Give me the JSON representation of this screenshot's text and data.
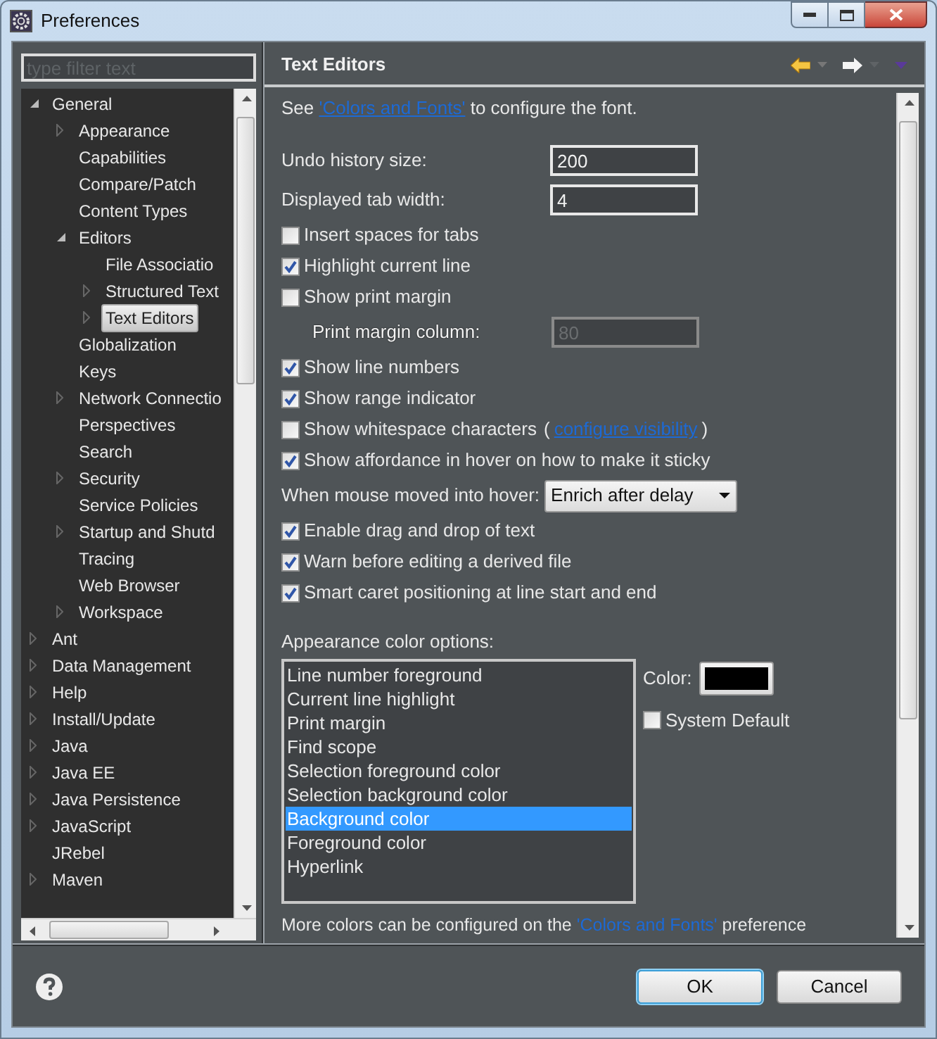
{
  "window": {
    "title": "Preferences"
  },
  "filter": {
    "placeholder": "type filter text"
  },
  "tree": [
    {
      "label": "General",
      "expanded": true,
      "selected": false,
      "children": [
        {
          "label": "Appearance",
          "expanded": false,
          "selected": false
        },
        {
          "label": "Capabilities",
          "selected": false
        },
        {
          "label": "Compare/Patch",
          "selected": false
        },
        {
          "label": "Content Types",
          "selected": false
        },
        {
          "label": "Editors",
          "expanded": true,
          "selected": false,
          "children": [
            {
              "label": "File Associatio",
              "selected": false
            },
            {
              "label": "Structured Text",
              "expanded": false,
              "selected": false
            },
            {
              "label": "Text Editors",
              "expanded": false,
              "selected": true
            }
          ]
        },
        {
          "label": "Globalization",
          "selected": false
        },
        {
          "label": "Keys",
          "selected": false
        },
        {
          "label": "Network Connectio",
          "expanded": false,
          "selected": false
        },
        {
          "label": "Perspectives",
          "selected": false
        },
        {
          "label": "Search",
          "selected": false
        },
        {
          "label": "Security",
          "expanded": false,
          "selected": false
        },
        {
          "label": "Service Policies",
          "selected": false
        },
        {
          "label": "Startup and Shutd",
          "expanded": false,
          "selected": false
        },
        {
          "label": "Tracing",
          "selected": false
        },
        {
          "label": "Web Browser",
          "selected": false
        },
        {
          "label": "Workspace",
          "expanded": false,
          "selected": false
        }
      ]
    },
    {
      "label": "Ant",
      "expanded": false,
      "selected": false
    },
    {
      "label": "Data Management",
      "expanded": false,
      "selected": false
    },
    {
      "label": "Help",
      "expanded": false,
      "selected": false
    },
    {
      "label": "Install/Update",
      "expanded": false,
      "selected": false
    },
    {
      "label": "Java",
      "expanded": false,
      "selected": false
    },
    {
      "label": "Java EE",
      "expanded": false,
      "selected": false
    },
    {
      "label": "Java Persistence",
      "expanded": false,
      "selected": false
    },
    {
      "label": "JavaScript",
      "expanded": false,
      "selected": false
    },
    {
      "label": "JRebel",
      "selected": false
    },
    {
      "label": "Maven",
      "expanded": false,
      "selected": false
    }
  ],
  "page": {
    "title": "Text Editors",
    "intro": {
      "prefix": "See ",
      "link": "'Colors and Fonts'",
      "suffix": " to configure the font."
    },
    "settings": [
      {
        "kind": "field",
        "label": "Undo history size:",
        "value": "200",
        "disabled": false
      },
      {
        "kind": "field",
        "label": "Displayed tab width:",
        "value": "4",
        "disabled": false
      },
      {
        "kind": "checkbox",
        "label": "Insert spaces for tabs",
        "checked": false
      },
      {
        "kind": "checkbox",
        "label": "Highlight current line",
        "checked": true
      },
      {
        "kind": "checkbox",
        "label": "Show print margin",
        "checked": false,
        "children": [
          {
            "kind": "field",
            "label": "Print margin column:",
            "value": "80",
            "disabled": true
          }
        ]
      },
      {
        "kind": "checkbox",
        "label": "Show line numbers",
        "checked": true
      },
      {
        "kind": "checkbox",
        "label": "Show range indicator",
        "checked": true
      },
      {
        "kind": "checkbox",
        "label": "Show whitespace characters",
        "checked": false,
        "paren_open": "(",
        "link": "configure visibility",
        "paren_close": ")"
      },
      {
        "kind": "checkbox",
        "label": "Show affordance in hover on how to make it sticky",
        "checked": true
      },
      {
        "kind": "dropdown",
        "label": "When mouse moved into hover:",
        "value": "Enrich after delay"
      },
      {
        "kind": "checkbox",
        "label": "Enable drag and drop of text",
        "checked": true
      },
      {
        "kind": "checkbox",
        "label": "Warn before editing a derived file",
        "checked": true
      },
      {
        "kind": "checkbox",
        "label": "Smart caret positioning at line start and end",
        "checked": true
      }
    ],
    "colors": {
      "label": "Appearance color options:",
      "options": [
        {
          "label": "Line number foreground",
          "selected": false
        },
        {
          "label": "Current line highlight",
          "selected": false
        },
        {
          "label": "Print margin",
          "selected": false
        },
        {
          "label": "Find scope",
          "selected": false
        },
        {
          "label": "Selection foreground color",
          "selected": false
        },
        {
          "label": "Selection background color",
          "selected": false
        },
        {
          "label": "Background color",
          "selected": true
        },
        {
          "label": "Foreground color",
          "selected": false
        },
        {
          "label": "Hyperlink",
          "selected": false
        }
      ],
      "color_label": "Color:",
      "color": "#000000",
      "system_default": {
        "label": "System Default",
        "checked": false
      }
    },
    "note": {
      "prefix": "More colors can be configured on the ",
      "link": "'Colors and Fonts'",
      "suffix": " preference"
    }
  },
  "buttons": [
    {
      "label": "OK",
      "default": true
    },
    {
      "label": "Cancel",
      "default": false
    }
  ]
}
